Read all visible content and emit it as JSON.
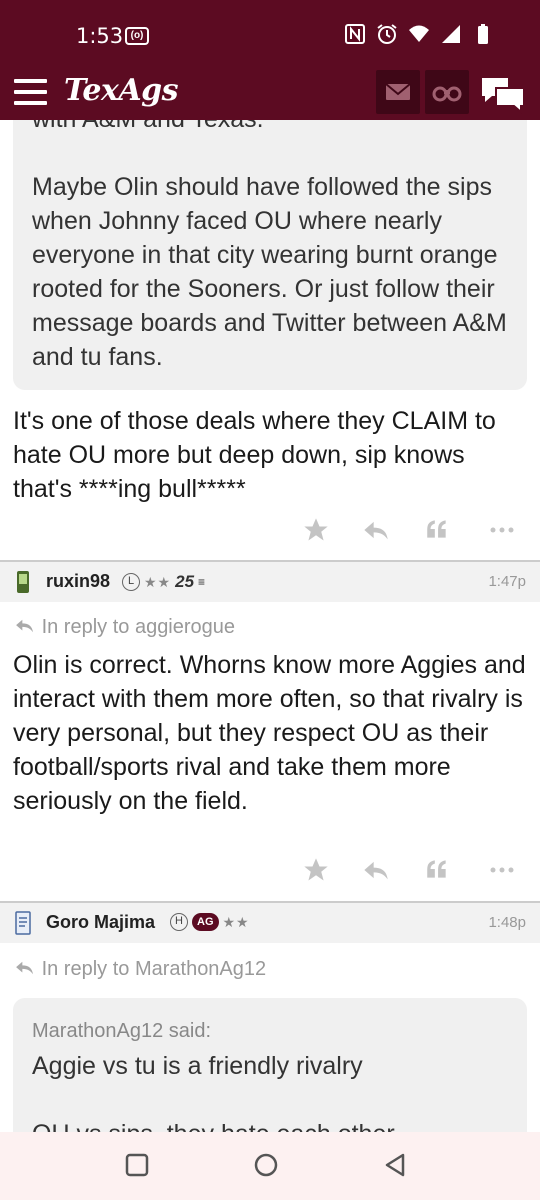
{
  "status_bar": {
    "time": "1:53",
    "cast_label": "(o)"
  },
  "nav": {
    "logo": "TexAgs",
    "icons": [
      "menu-icon",
      "mail-icon",
      "binoculars-icon",
      "chat-icon"
    ]
  },
  "thread": {
    "quote_clip": "with A&M and Texas.",
    "quote_paragraph": "Maybe Olin should have followed the sips when Johnny faced OU where nearly everyone in that city wearing burnt orange rooted for the Sooners. Or just follow their message boards and Twitter between A&M and tu fans.",
    "post1_text": "It's one of those deals where they CLAIM to hate OU more but deep down, sip knows that's ****ing bull*****",
    "post2": {
      "username": "ruxin98",
      "badge_l": "L",
      "stars": "★★",
      "years": "25",
      "time": "1:47p",
      "reply_to": "In reply to aggierogue",
      "text": "Olin is correct. Whorns know more Aggies and interact with them more often, so that rivalry is very personal, but they respect OU as their football/sports rival and take them more seriously on the field."
    },
    "post3": {
      "username": "Goro Majima",
      "badge_h": "H",
      "badge_ag": "AG",
      "stars": "★★",
      "time": "1:48p",
      "reply_to": "In reply to MarathonAg12",
      "quote_author": "MarathonAg12 said:",
      "quote_line1": "Aggie vs tu is a friendly rivalry",
      "quote_line2": "OU vs sips, they hate each other"
    }
  },
  "colors": {
    "brand": "#5c0b22",
    "quote_bg": "#f0f0f0",
    "muted": "#999999"
  }
}
